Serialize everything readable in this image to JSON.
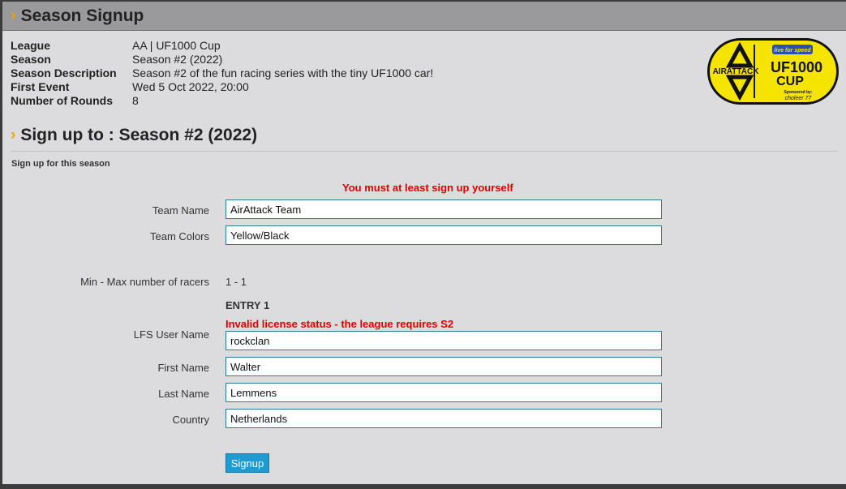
{
  "header": {
    "title": "Season Signup"
  },
  "info": {
    "rows": [
      {
        "label": "League",
        "value": "AA | UF1000 Cup"
      },
      {
        "label": "Season",
        "value": "Season #2 (2022)"
      },
      {
        "label": "Season Description",
        "value": "Season #2 of the fun racing series with the tiny UF1000 car!"
      },
      {
        "label": "First Event",
        "value": "Wed 5 Oct 2022, 20:00"
      },
      {
        "label": "Number of Rounds",
        "value": "8"
      }
    ]
  },
  "logo": {
    "left_text": "AIRATTACK",
    "top_badge": "live for speed",
    "main_line1": "UF1000",
    "main_line2": "CUP",
    "sponsor_label": "Sponsored by:",
    "sponsor_name": "choleer 77",
    "colors": {
      "yellow": "#f5e400",
      "black": "#111111",
      "blue": "#2a4fb0"
    }
  },
  "signup": {
    "title": "Sign up to : Season #2 (2022)",
    "subtitle": "Sign up for this season",
    "error_self": "You must at least sign up yourself",
    "team_name_label": "Team Name",
    "team_name_value": "AirAttack Team",
    "team_colors_label": "Team Colors",
    "team_colors_value": "Yellow/Black",
    "racers_label": "Min - Max number of racers",
    "racers_value": "1 - 1",
    "entry_label": "ENTRY 1",
    "license_error": "Invalid license status - the league requires S2",
    "lfs_user_label": "LFS User Name",
    "lfs_user_value": "rockclan",
    "first_name_label": "First Name",
    "first_name_value": "Walter",
    "last_name_label": "Last Name",
    "last_name_value": "Lemmens",
    "country_label": "Country",
    "country_value": "Netherlands",
    "button_label": "Signup"
  },
  "colors": {
    "accent_chevron": "#f0a400",
    "error": "#e00000",
    "button": "#1f9bd1",
    "input_border": "#2a7f95"
  }
}
